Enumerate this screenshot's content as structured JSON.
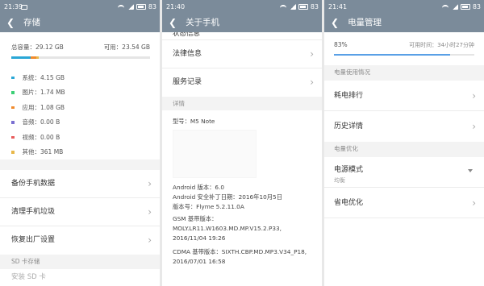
{
  "panel1": {
    "status_time": "21:39",
    "battery": "83",
    "title": "存储",
    "total_label": "总容量：29.12 GB",
    "available_label": "可用：23.54 GB",
    "legend": [
      {
        "label": "系统：4.15 GB",
        "color": "#2aa7d6"
      },
      {
        "label": "图片：1.74 MB",
        "color": "#3ccf76"
      },
      {
        "label": "应用：1.08 GB",
        "color": "#f08a2c"
      },
      {
        "label": "音频：0.00 B",
        "color": "#7a6fd1"
      },
      {
        "label": "视频：0.00 B",
        "color": "#e85c5c"
      },
      {
        "label": "其他：361 MB",
        "color": "#e8b84a"
      }
    ],
    "usage_fraction_system": 0.14,
    "usage_fraction_apps": 0.04,
    "menu": [
      "备份手机数据",
      "清理手机垃圾",
      "恢复出厂设置"
    ],
    "sd_section": "SD 卡存储",
    "sd_item": "安装 SD 卡"
  },
  "panel2": {
    "status_time": "21:40",
    "battery": "83",
    "title": "关于手机",
    "cut_item": "状态信息",
    "menu": [
      "法律信息",
      "服务记录"
    ],
    "section": "详情",
    "model": "型号：M5 Note",
    "android_version": "Android 版本：6.0",
    "security_patch": "Android 安全补丁日期：2016年10月5日",
    "version": "版本号：Flyme 5.2.11.0A",
    "gsm_label": "GSM 基带版本：",
    "gsm_value": "MOLY.LR11.W1603.MD.MP.V15.2.P33,",
    "gsm_date": "2016/11/04 19:26",
    "cdma_label": "CDMA 基带版本：SIXTH.CBP.MD.MP3.V34_P18,",
    "cdma_date": "2016/07/01 16:58"
  },
  "panel3": {
    "status_time": "21:41",
    "battery": "83",
    "title": "电量管理",
    "percent": "83%",
    "available_time": "可用时间：34小时27分钟",
    "level": 0.83,
    "section_usage": "电量使用情况",
    "usage_items": [
      "耗电排行",
      "历史详情"
    ],
    "section_opt": "电量优化",
    "power_mode_title": "电源模式",
    "power_mode_value": "均衡",
    "save_item": "省电优化"
  }
}
